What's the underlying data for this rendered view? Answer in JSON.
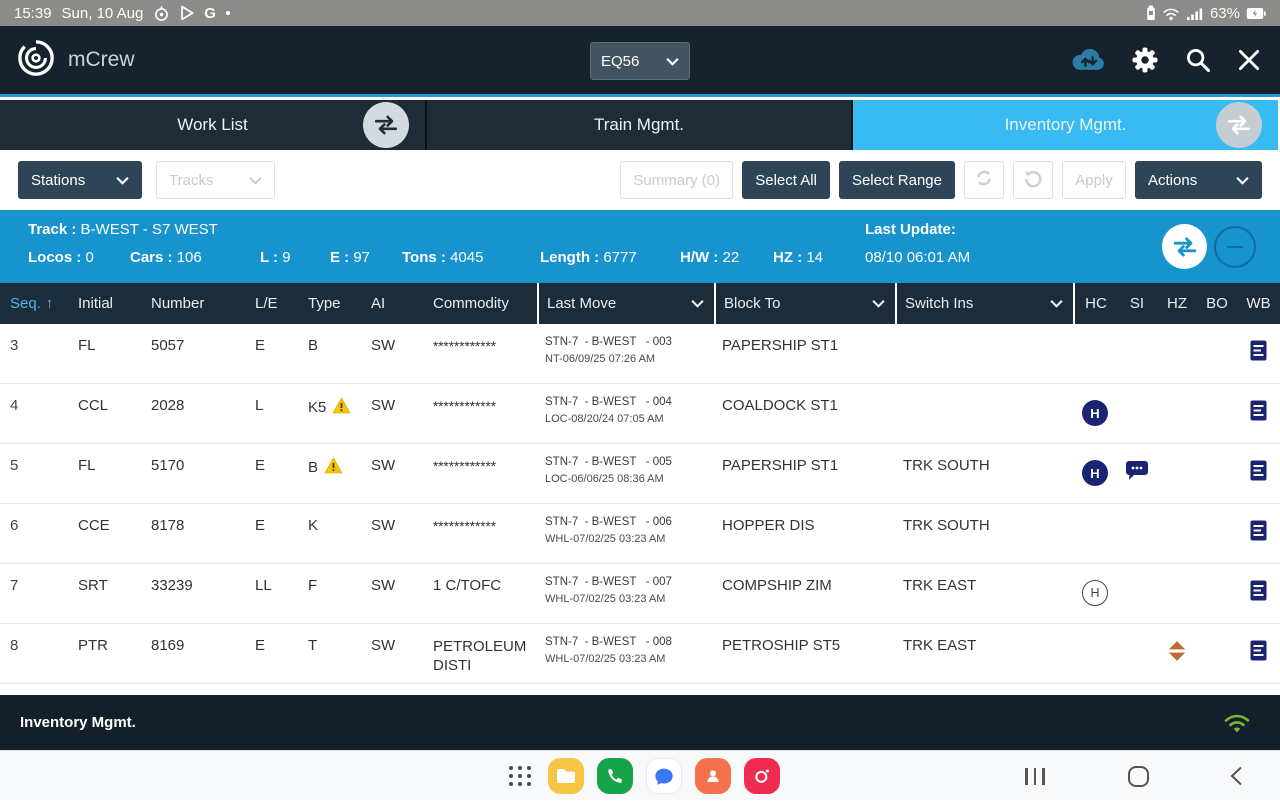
{
  "status_bar": {
    "time": "15:39",
    "date": "Sun, 10 Aug",
    "battery_pct": "63%"
  },
  "header": {
    "app_name": "mCrew",
    "equipment_selector": "EQ56"
  },
  "tabs": {
    "work_list": "Work List",
    "train_mgmt": "Train Mgmt.",
    "inventory_mgmt": "Inventory Mgmt.",
    "active_tab": "Inventory Mgmt."
  },
  "toolbar": {
    "stations": "Stations",
    "tracks": "Tracks",
    "summary": "Summary (0)",
    "select_all": "Select All",
    "select_range": "Select Range",
    "apply": "Apply",
    "actions": "Actions"
  },
  "track_summary": {
    "track_label": "Track :",
    "track_value": "B-WEST - S7 WEST",
    "locos_label": "Locos :",
    "locos": "0",
    "cars_label": "Cars :",
    "cars": "106",
    "l_label": "L :",
    "l": "9",
    "e_label": "E :",
    "e": "97",
    "tons_label": "Tons :",
    "tons": "4045",
    "length_label": "Length :",
    "length": "6777",
    "hw_label": "H/W :",
    "hw": "22",
    "hz_label": "HZ :",
    "hz": "14",
    "last_update_label": "Last Update:",
    "last_update_value": "08/10 06:01 AM"
  },
  "table": {
    "columns": [
      "Seq.",
      "Initial",
      "Number",
      "L/E",
      "Type",
      "AI",
      "Commodity",
      "Last Move",
      "Block To",
      "Switch Ins",
      "HC",
      "SI",
      "HZ",
      "BO",
      "WB"
    ],
    "sort_indicator": "↑",
    "rows": [
      {
        "seq": "3",
        "initial": "FL",
        "number": "5057",
        "le": "E",
        "type": "B",
        "has_warning": false,
        "ai": "SW",
        "commodity": "************",
        "last_move_line1": "STN-7  - B-WEST   - 003",
        "last_move_line2": "NT-06/09/25 07:26 AM",
        "block_to": "PAPERSHIP ST1",
        "switch_ins": "",
        "icons": {
          "wb": "document"
        }
      },
      {
        "seq": "4",
        "initial": "CCL",
        "number": "2028",
        "le": "L",
        "type": "K5",
        "has_warning": true,
        "ai": "SW",
        "commodity": "************",
        "last_move_line1": "STN-7  - B-WEST   - 004",
        "last_move_line2": "LOC-08/20/24 07:05 AM",
        "block_to": "COALDOCK ST1",
        "switch_ins": "",
        "icons": {
          "hc": "h-circle-filled",
          "wb": "document"
        }
      },
      {
        "seq": "5",
        "initial": "FL",
        "number": "5170",
        "le": "E",
        "type": "B",
        "has_warning": true,
        "ai": "SW",
        "commodity": "************",
        "last_move_line1": "STN-7  - B-WEST   - 005",
        "last_move_line2": "LOC-06/06/25 08:36 AM",
        "block_to": "PAPERSHIP ST1",
        "switch_ins": "TRK SOUTH",
        "icons": {
          "hc": "h-circle-filled",
          "si": "comment-bubble",
          "wb": "document"
        }
      },
      {
        "seq": "6",
        "initial": "CCE",
        "number": "8178",
        "le": "E",
        "type": "K",
        "has_warning": false,
        "ai": "SW",
        "commodity": "************",
        "last_move_line1": "STN-7  - B-WEST   - 006",
        "last_move_line2": "WHL-07/02/25 03:23 AM",
        "block_to": "HOPPER DIS",
        "switch_ins": "TRK SOUTH",
        "icons": {
          "wb": "document"
        }
      },
      {
        "seq": "7",
        "initial": "SRT",
        "number": "33239",
        "le": "LL",
        "type": "F",
        "has_warning": false,
        "ai": "SW",
        "commodity": "1 C/TOFC",
        "last_move_line1": "STN-7  - B-WEST   - 007",
        "last_move_line2": "WHL-07/02/25 03:23 AM",
        "block_to": "COMPSHIP ZIM",
        "switch_ins": "TRK EAST",
        "icons": {
          "hc": "h-circle-outline",
          "wb": "document"
        }
      },
      {
        "seq": "8",
        "initial": "PTR",
        "number": "8169",
        "le": "E",
        "type": "T",
        "has_warning": false,
        "ai": "SW",
        "commodity": "PETROLEUM DISTI",
        "last_move_line1": "STN-7  - B-WEST   - 008",
        "last_move_line2": "WHL-07/02/25 03:23 AM",
        "block_to": "PETROSHIP ST5",
        "switch_ins": "TRK EAST",
        "icons": {
          "hz": "hazmat-diamond",
          "wb": "document"
        }
      }
    ]
  },
  "footer": {
    "title": "Inventory Mgmt."
  },
  "colors": {
    "active_tab_blue": "#38bbf2",
    "summary_bar_blue": "#1794ce",
    "header_dark": "#16222d",
    "table_header_dark": "#1d2c3a",
    "navy_icon": "#1a2472",
    "warning_yellow": "#f2c40f",
    "hazmat_orange": "#c06a2e",
    "wifi_green": "#7db52f",
    "sort_blue": "#4cb8e9"
  }
}
